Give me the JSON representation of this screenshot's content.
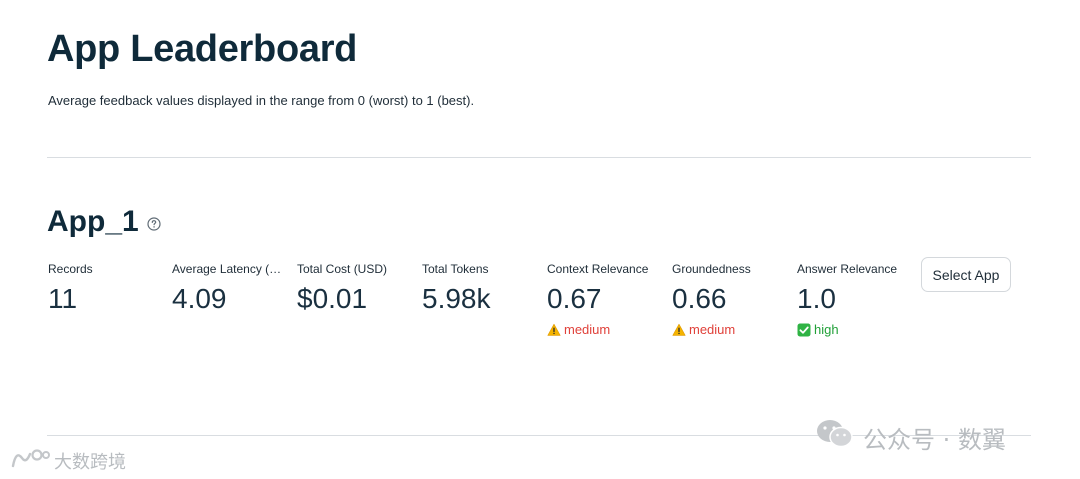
{
  "header": {
    "title": "App Leaderboard",
    "subtitle": "Average feedback values displayed in the range from 0 (worst) to 1 (best)."
  },
  "app": {
    "name": "App_1",
    "help_icon": "question-circle-icon",
    "metrics": [
      {
        "label": "Records",
        "value": "11"
      },
      {
        "label": "Average Latency (…",
        "value": "4.09"
      },
      {
        "label": "Total Cost (USD)",
        "value": "$0.01"
      },
      {
        "label": "Total Tokens",
        "value": "5.98k"
      },
      {
        "label": "Context Relevance",
        "value": "0.67",
        "status": "medium",
        "status_icon": "warning-icon"
      },
      {
        "label": "Groundedness",
        "value": "0.66",
        "status": "medium",
        "status_icon": "warning-icon"
      },
      {
        "label": "Answer Relevance",
        "value": "1.0",
        "status": "high",
        "status_icon": "check-box-icon"
      }
    ],
    "select_button": "Select App"
  },
  "colors": {
    "title": "#0f2a3a",
    "medium": "#e0413a",
    "high": "#21a038",
    "divider": "#d9dde1"
  },
  "watermarks": {
    "right": "公众号 · 数翼",
    "left": "大数跨境"
  }
}
